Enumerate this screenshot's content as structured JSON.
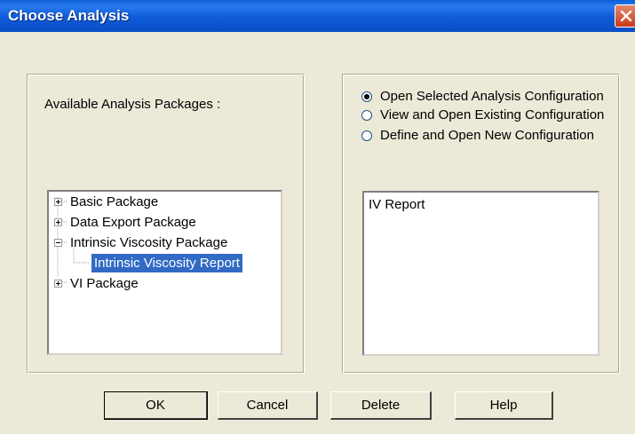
{
  "window": {
    "title": "Choose Analysis"
  },
  "packages": {
    "label": "Available Analysis Packages :",
    "items": [
      {
        "label": "Basic Package",
        "expander": "plus"
      },
      {
        "label": "Data Export Package",
        "expander": "plus"
      },
      {
        "label": "Intrinsic Viscosity Package",
        "expander": "minus"
      },
      {
        "label": "Intrinsic Viscosity Report",
        "expander": "none",
        "selected": true
      },
      {
        "label": "VI Package",
        "expander": "plus"
      }
    ]
  },
  "options": {
    "open_selected": "Open Selected Analysis Configuration",
    "view_existing": "View and Open Existing Configuration",
    "define_new": "Define and Open New Configuration",
    "selected_option": "open_selected"
  },
  "configurations": {
    "items": [
      "IV Report"
    ]
  },
  "buttons": {
    "ok": "OK",
    "cancel": "Cancel",
    "delete": "Delete",
    "help": "Help"
  },
  "colors": {
    "titlebar": "#0a5fd8",
    "selection": "#316ac5",
    "dialog_bg": "#ece9d8"
  }
}
